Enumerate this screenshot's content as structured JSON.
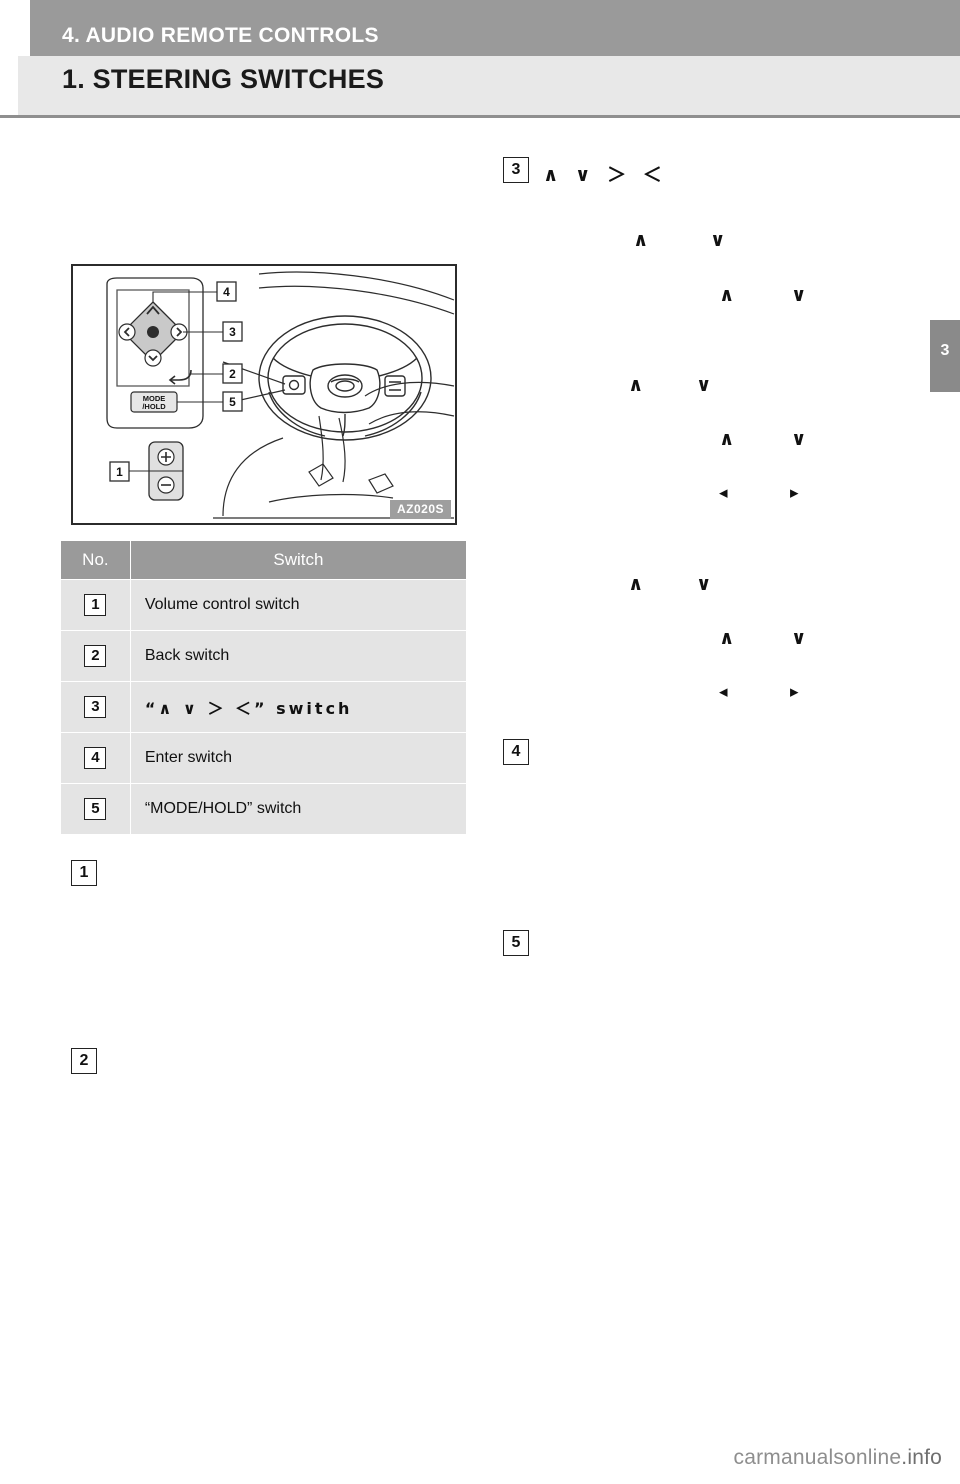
{
  "header": {
    "chapter_label": "4. AUDIO REMOTE CONTROLS",
    "section_title": "1. STEERING SWITCHES",
    "chapter_tab_number": "3"
  },
  "illustration": {
    "code": "AZ020S",
    "callouts": [
      "1",
      "2",
      "3",
      "4",
      "5"
    ],
    "mode_hold_label_line1": "MODE",
    "mode_hold_label_line2": "/HOLD",
    "plus_symbol": "+",
    "minus_symbol": "−"
  },
  "table": {
    "headers": [
      "No.",
      "Switch"
    ],
    "rows": [
      {
        "no": "1",
        "switch": "Volume control switch"
      },
      {
        "no": "2",
        "switch": "Back switch"
      },
      {
        "no": "3",
        "switch": "“∧  ∨  ＞  ＜” switch"
      },
      {
        "no": "4",
        "switch": "Enter switch"
      },
      {
        "no": "5",
        "switch": "“MODE/HOLD” switch"
      }
    ]
  },
  "left_column_markers": [
    {
      "label": "1"
    },
    {
      "label": "2"
    }
  ],
  "right_column": {
    "item3_label": "3",
    "item3_arrows": "∧ ∨ ＞ ＜",
    "item4_label": "4",
    "item5_label": "5",
    "arrow_rows": [
      {
        "left": "∧",
        "right": "∨"
      },
      {
        "left": "∧",
        "right": "∨"
      },
      {
        "left": "∧",
        "right": "∨"
      },
      {
        "left": "∧",
        "right": "∨"
      },
      {
        "left": "◂",
        "right": "▸"
      },
      {
        "left": "∧",
        "right": "∨"
      },
      {
        "left": "∧",
        "right": "∨"
      },
      {
        "left": "◂",
        "right": "▸"
      }
    ]
  },
  "footer": {
    "watermark_plain": "carmanualsonline",
    "watermark_suffix": ".info"
  }
}
